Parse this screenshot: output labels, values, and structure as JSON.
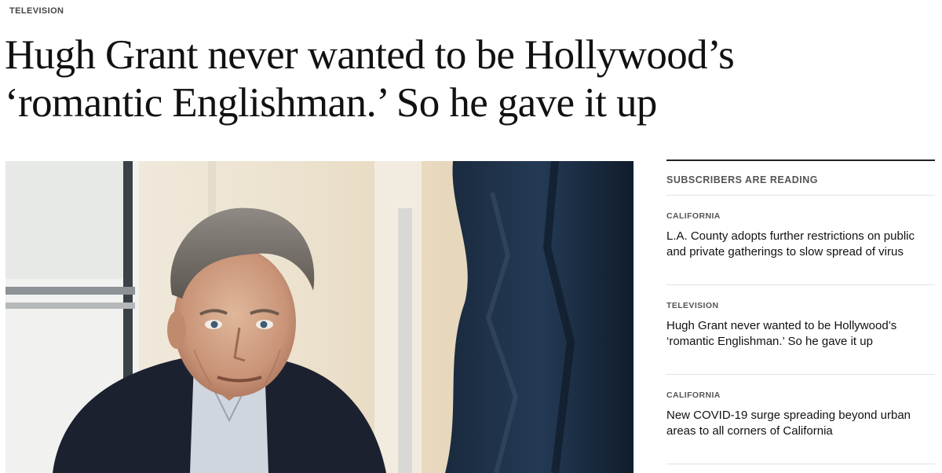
{
  "article": {
    "section": "TELEVISION",
    "headline": "Hugh Grant never wanted to be Hollywood’s ‘romantic Englishman.’ So he gave it up"
  },
  "sidebar": {
    "heading": "SUBSCRIBERS ARE READING",
    "stories": [
      {
        "section": "CALIFORNIA",
        "title": "L.A. County adopts further restrictions on public and private gatherings to slow spread of virus"
      },
      {
        "section": "TELEVISION",
        "title": "Hugh Grant never wanted to be Hollywood’s ‘romantic Englishman.’ So he gave it up"
      },
      {
        "section": "CALIFORNIA",
        "title": "New COVID-19 surge spreading beyond urban areas to all corners of California"
      }
    ]
  }
}
